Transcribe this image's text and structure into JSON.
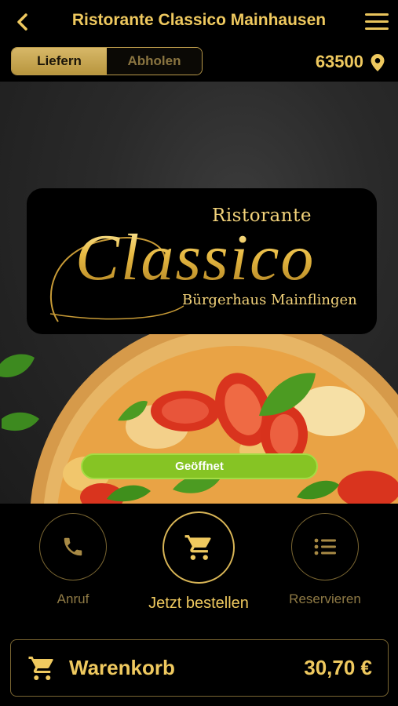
{
  "header": {
    "title": "Ristorante Classico Mainhausen",
    "back_icon": "chevron-left-icon",
    "menu_icon": "hamburger-menu-icon"
  },
  "mode": {
    "delivery_label": "Liefern",
    "pickup_label": "Abholen",
    "active": "Liefern",
    "zip_code": "63500",
    "location_icon": "map-pin-icon"
  },
  "hero": {
    "logo": {
      "top_line": "Ristorante",
      "name": "Classico",
      "sub_line": "Bürgerhaus Mainflingen"
    },
    "status": "Geöffnet",
    "status_color": "#86c424"
  },
  "actions": [
    {
      "label": "Anruf",
      "icon": "phone-icon"
    },
    {
      "label": "Jetzt bestellen",
      "icon": "shopping-cart-icon"
    },
    {
      "label": "Reservieren",
      "icon": "list-icon"
    }
  ],
  "cart": {
    "label": "Warenkorb",
    "total": "30,70 €",
    "icon": "shopping-cart-icon"
  },
  "colors": {
    "accent_gold": "#efc95f",
    "background": "#000000"
  }
}
